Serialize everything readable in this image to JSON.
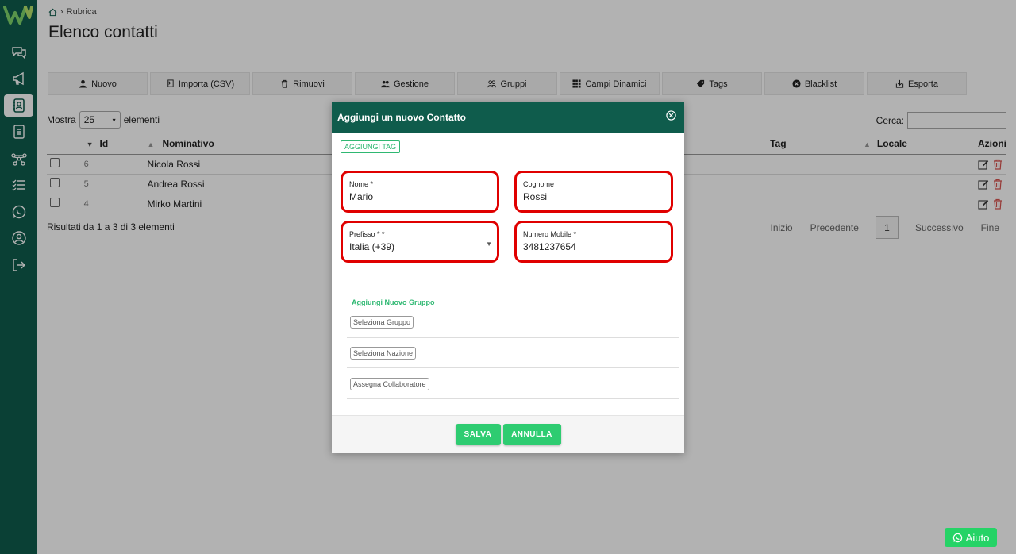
{
  "colors": {
    "brand": "#0f5c4c",
    "accent": "#2ecc71",
    "highlight": "#e00000",
    "whatsapp": "#25d366"
  },
  "sidebar": {
    "items": [
      {
        "icon": "chat-icon",
        "active": false
      },
      {
        "icon": "megaphone-icon",
        "active": false
      },
      {
        "icon": "contacts-book-icon",
        "active": true
      },
      {
        "icon": "document-icon",
        "active": false
      },
      {
        "icon": "flow-icon",
        "active": false
      },
      {
        "icon": "checklist-icon",
        "active": false
      },
      {
        "icon": "whatsapp-icon",
        "active": false
      },
      {
        "icon": "user-circle-icon",
        "active": false
      },
      {
        "icon": "logout-icon",
        "active": false
      }
    ]
  },
  "breadcrumb": {
    "label": "Rubrica"
  },
  "page": {
    "title": "Elenco contatti"
  },
  "toolbar": {
    "buttons": [
      {
        "label": "Nuovo",
        "icon": "user-icon"
      },
      {
        "label": "Importa (CSV)",
        "icon": "import-icon"
      },
      {
        "label": "Rimuovi",
        "icon": "trash-icon"
      },
      {
        "label": "Gestione",
        "icon": "users-icon"
      },
      {
        "label": "Gruppi",
        "icon": "group-icon"
      },
      {
        "label": "Campi Dinamici",
        "icon": "grid-icon"
      },
      {
        "label": "Tags",
        "icon": "tag-icon"
      },
      {
        "label": "Blacklist",
        "icon": "block-icon"
      },
      {
        "label": "Esporta",
        "icon": "export-icon"
      }
    ]
  },
  "table": {
    "length_prefix": "Mostra",
    "length_value": "25",
    "length_suffix": "elementi",
    "search_label": "Cerca:",
    "columns": {
      "id": "Id",
      "name": "Nominativo",
      "tag": "Tag",
      "locale": "Locale",
      "actions": "Azioni"
    },
    "rows": [
      {
        "id": "6",
        "name": "Nicola Rossi"
      },
      {
        "id": "5",
        "name": "Andrea Rossi"
      },
      {
        "id": "4",
        "name": "Mirko Martini"
      }
    ],
    "info": "Risultati da 1 a 3 di 3 elementi",
    "pager": {
      "first": "Inizio",
      "prev": "Precedente",
      "current": "1",
      "next": "Successivo",
      "last": "Fine"
    }
  },
  "modal": {
    "title": "Aggiungi un nuovo Contatto",
    "tag_button": "AGGIUNGI TAG",
    "fields": {
      "nome": {
        "label": "Nome *",
        "value": "Mario"
      },
      "cognome": {
        "label": "Cognome",
        "value": "Rossi"
      },
      "prefisso": {
        "label": "Prefisso * *",
        "value": "Italia (+39)"
      },
      "mobile": {
        "label": "Numero Mobile *",
        "value": "3481237654"
      }
    },
    "group_link": "Aggiungi Nuovo Gruppo",
    "chips": {
      "gruppo": "Seleziona Gruppo",
      "nazione": "Seleziona Nazione",
      "collaboratore": "Assegna Collaboratore"
    },
    "save": "SALVA",
    "cancel": "ANNULLA"
  },
  "help": {
    "label": "Aiuto"
  }
}
